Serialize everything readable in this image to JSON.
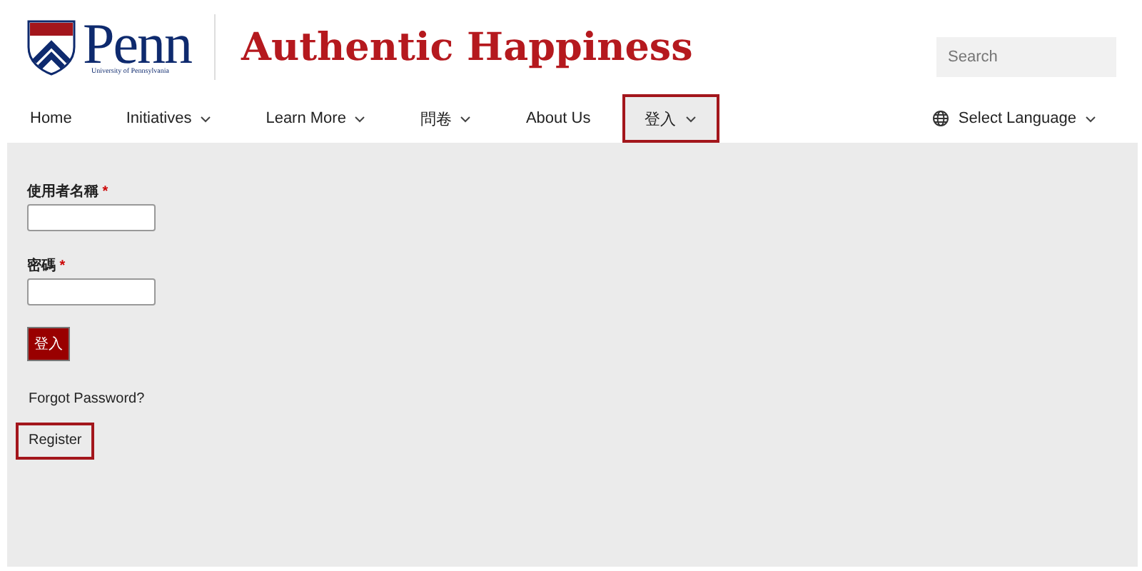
{
  "logo": {
    "wordmark": "Penn",
    "subtitle": "University of Pennsylvania"
  },
  "site_title": "Authentic Happiness",
  "search": {
    "placeholder": "Search"
  },
  "nav": [
    {
      "label": "Home",
      "dropdown": false,
      "selected": false,
      "highlighted": false
    },
    {
      "label": "Initiatives",
      "dropdown": true,
      "selected": false,
      "highlighted": false
    },
    {
      "label": "Learn More",
      "dropdown": true,
      "selected": false,
      "highlighted": false
    },
    {
      "label": "問卷",
      "dropdown": true,
      "selected": false,
      "highlighted": false
    },
    {
      "label": "About Us",
      "dropdown": false,
      "selected": false,
      "highlighted": false
    },
    {
      "label": "登入",
      "dropdown": true,
      "selected": true,
      "highlighted": true
    }
  ],
  "language": {
    "label": "Select Language"
  },
  "form": {
    "fields": [
      {
        "label": "使用者名稱",
        "required_mark": "*"
      },
      {
        "label": "密碼",
        "required_mark": "*"
      }
    ],
    "submit": "登入",
    "links": [
      {
        "label": "Forgot Password?",
        "highlighted": false
      },
      {
        "label": "Register",
        "highlighted": true
      }
    ]
  }
}
